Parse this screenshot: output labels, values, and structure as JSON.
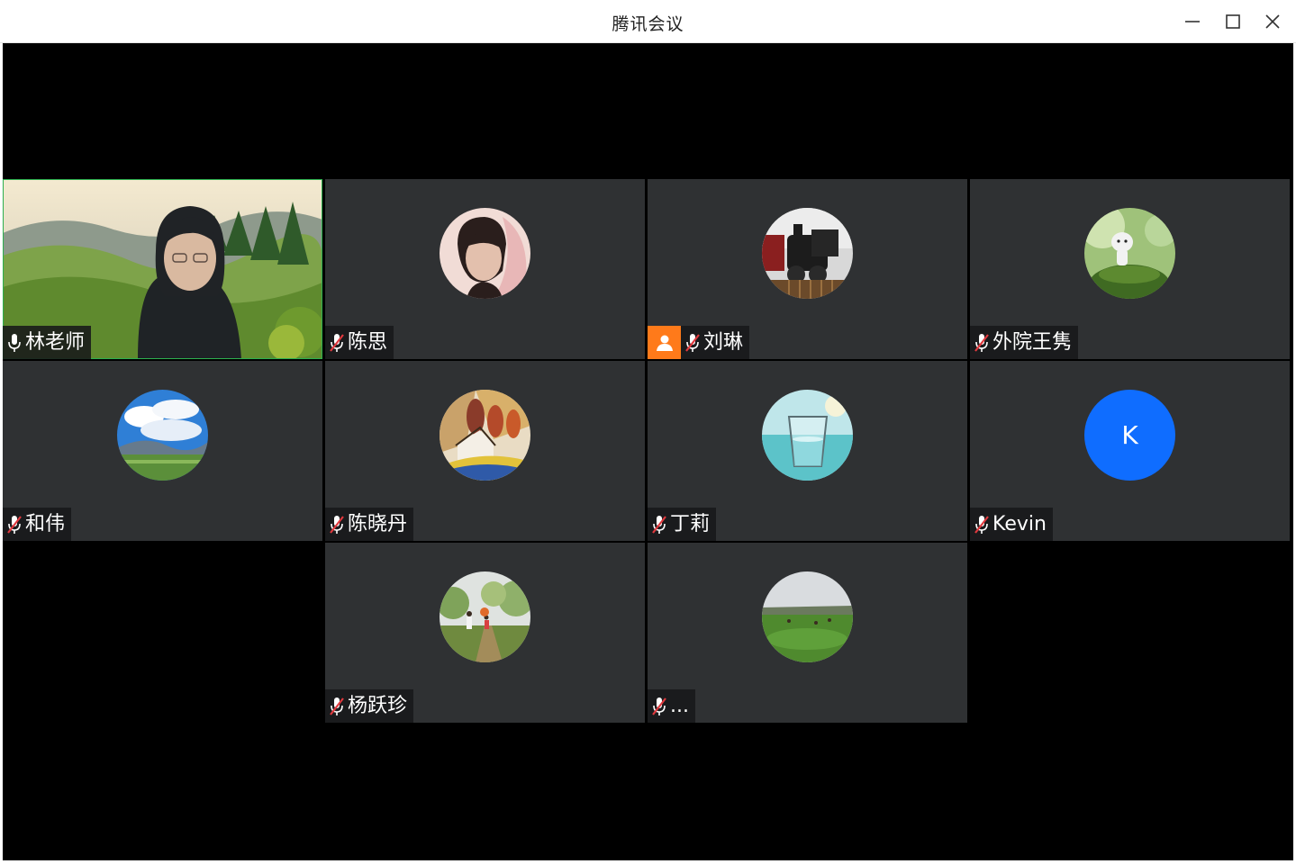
{
  "window": {
    "title": "腾讯会议",
    "controls": [
      "minimize-icon",
      "maximize-icon",
      "close-icon"
    ]
  },
  "participants": [
    {
      "name": "林老师",
      "mic": "on",
      "video": true,
      "speaking": true
    },
    {
      "name": "陈思",
      "mic": "muted",
      "avatar": "photo-woman"
    },
    {
      "name": "刘琳",
      "mic": "muted",
      "avatar": "photo-train",
      "host_badge": true
    },
    {
      "name": "外院王隽",
      "mic": "muted",
      "avatar": "photo-figurine"
    },
    {
      "name": "和伟",
      "mic": "muted",
      "avatar": "photo-sky"
    },
    {
      "name": "陈晓丹",
      "mic": "muted",
      "avatar": "photo-painting"
    },
    {
      "name": "丁莉",
      "mic": "muted",
      "avatar": "photo-glass"
    },
    {
      "name": "Kevin",
      "mic": "muted",
      "avatar_initial": "K"
    },
    {
      "name": "杨跃珍",
      "mic": "muted",
      "avatar": "photo-park"
    },
    {
      "name": "...",
      "mic": "muted",
      "avatar": "photo-field"
    }
  ],
  "colors": {
    "stage_bg": "#000000",
    "tile_bg": "#2f3133",
    "speaking_border": "#2db04f",
    "muted_red": "#e0393e",
    "host_badge": "#ff7a1a",
    "initial_avatar": "#0f6dff"
  }
}
